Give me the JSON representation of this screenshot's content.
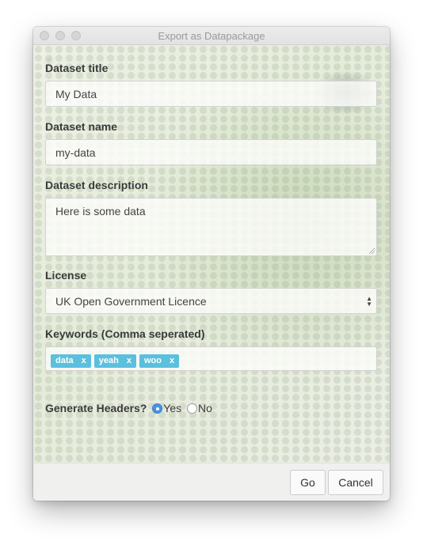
{
  "window": {
    "title": "Export as Datapackage"
  },
  "form": {
    "title_label": "Dataset title",
    "title_value": "My Data",
    "name_label": "Dataset name",
    "name_value": "my-data",
    "description_label": "Dataset description",
    "description_value": "Here is some data",
    "license_label": "License",
    "license_value": "UK Open Government Licence",
    "keywords_label": "Keywords (Comma seperated)",
    "keywords": [
      {
        "text": "data",
        "remove": "x"
      },
      {
        "text": "yeah",
        "remove": "x"
      },
      {
        "text": "woo",
        "remove": "x"
      }
    ],
    "headers_label": "Generate Headers?",
    "headers_yes": "Yes",
    "headers_no": "No"
  },
  "footer": {
    "go_label": "Go",
    "cancel_label": "Cancel"
  },
  "colors": {
    "tag": "#5bc0de",
    "radio_checked": "#4a90e2"
  }
}
